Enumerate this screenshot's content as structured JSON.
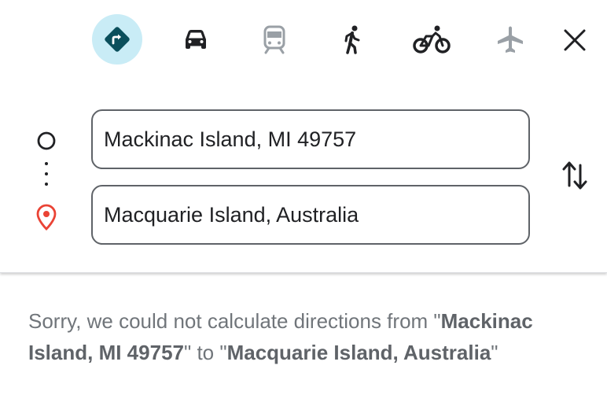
{
  "travel_modes": [
    {
      "id": "best",
      "icon": "directions-icon",
      "selected": true,
      "enabled": true
    },
    {
      "id": "driving",
      "icon": "car-icon",
      "selected": false,
      "enabled": true
    },
    {
      "id": "transit",
      "icon": "train-icon",
      "selected": false,
      "enabled": false
    },
    {
      "id": "walking",
      "icon": "walking-icon",
      "selected": false,
      "enabled": true
    },
    {
      "id": "cycling",
      "icon": "bicycle-icon",
      "selected": false,
      "enabled": true
    },
    {
      "id": "flights",
      "icon": "airplane-icon",
      "selected": false,
      "enabled": false
    }
  ],
  "colors": {
    "selected_bg": "#c9ecf6",
    "selected_icon": "#0b4f5c",
    "active_icon": "#202124",
    "disabled_icon": "#9aa0a6",
    "destination_pin": "#ea4335",
    "message_text": "#70757a"
  },
  "origin": {
    "value": "Mackinac Island, MI 49757"
  },
  "destination": {
    "value": "Macquarie Island, Australia"
  },
  "error_message": {
    "prefix": "Sorry, we could not calculate directions from \"",
    "origin": "Mackinac Island, MI 49757",
    "middle": "\" to \"",
    "destination": "Macquarie Island, Australia",
    "suffix": "\""
  }
}
